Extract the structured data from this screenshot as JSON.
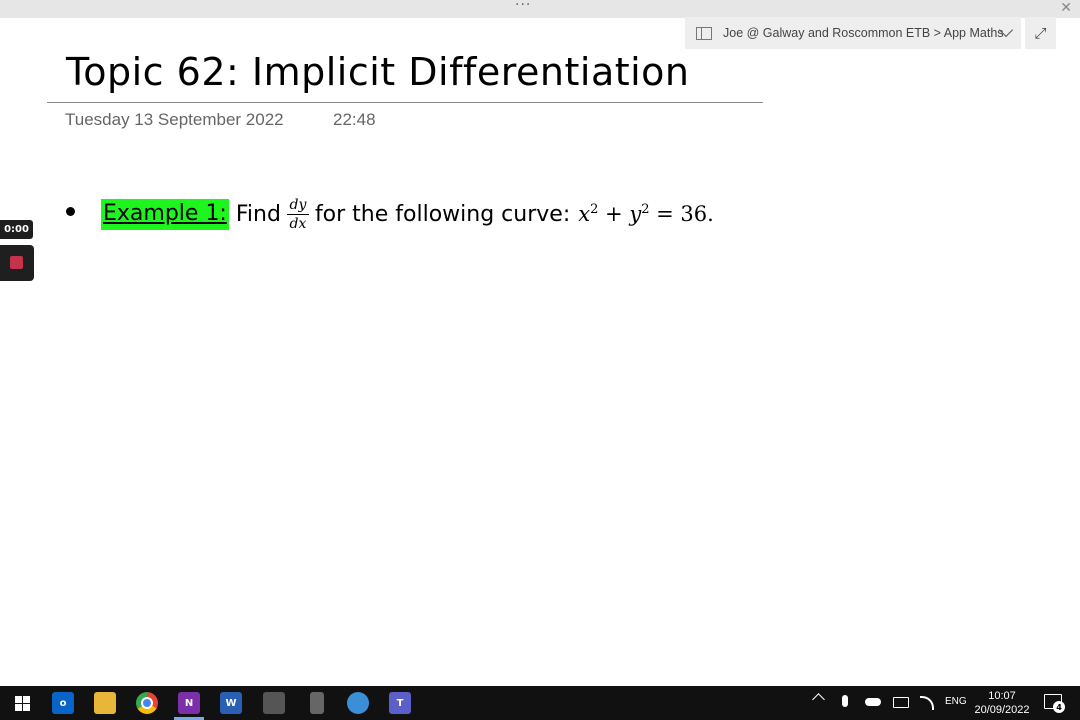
{
  "window": {
    "top_dots": "···",
    "close_glyph": "✕"
  },
  "breadcrumb": {
    "text": "Joe @ Galway and Roscommon ETB > App Maths",
    "expand_glyph": "⤢"
  },
  "page": {
    "title": "Topic 62: Implicit Differentiation",
    "date": "Tuesday 13 September 2022",
    "time": "22:48"
  },
  "recorder": {
    "elapsed": "0:00"
  },
  "content": {
    "example_label": "Example 1:",
    "find": "Find",
    "frac_num": "dy",
    "frac_den": "dx",
    "rest": "for the following curve:",
    "eq_x": "x",
    "eq_x_exp": "2",
    "eq_plus": " + ",
    "eq_y": "y",
    "eq_y_exp": "2",
    "eq_rhs": " = 36."
  },
  "colors": {
    "highlight": "#1ef51e",
    "recorder_stop": "#c4324b",
    "taskbar": "#111111"
  },
  "taskbar": {
    "icons": [
      "windows-start-icon",
      "outlook-icon",
      "file-explorer-icon",
      "chrome-icon",
      "onenote-icon",
      "word-icon",
      "calculator-icon",
      "phone-icon",
      "remote-desktop-icon",
      "teams-icon"
    ],
    "tray": {
      "language": "ENG",
      "time": "10:07",
      "date": "20/09/2022",
      "notifications": "4"
    }
  }
}
